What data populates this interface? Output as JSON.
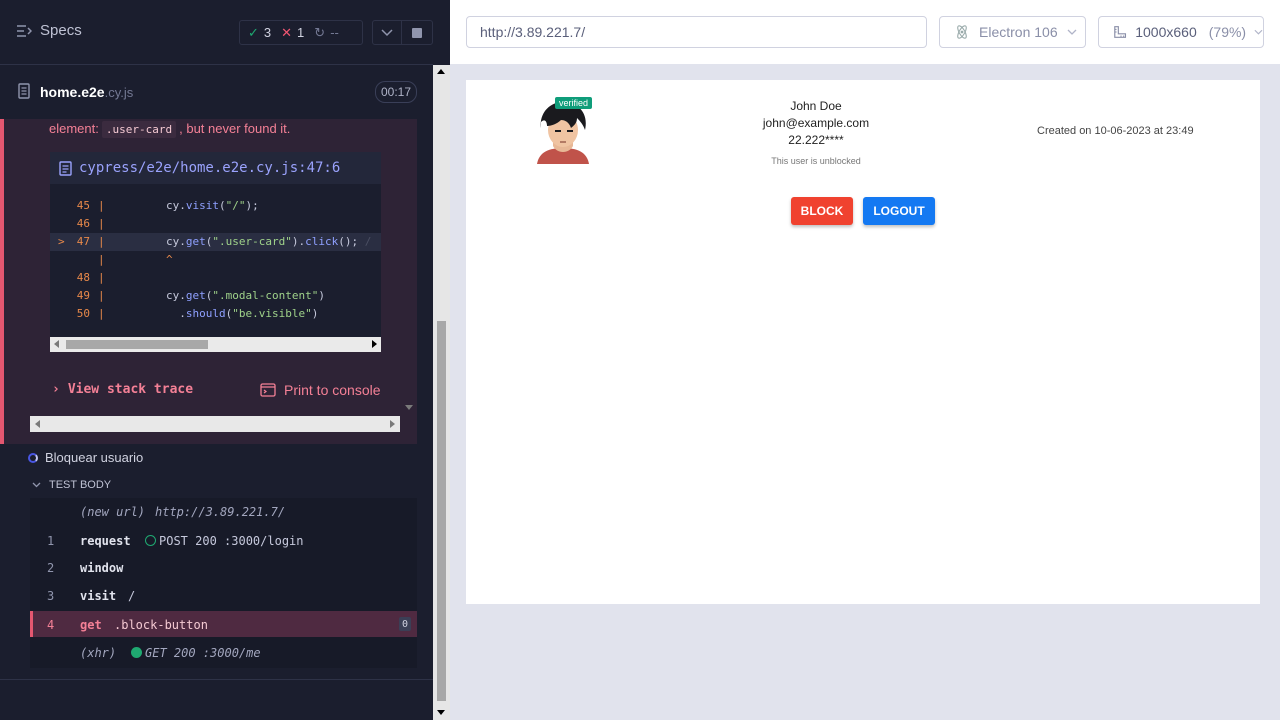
{
  "reporter": {
    "specs_label": "Specs",
    "stats": {
      "passed": "3",
      "failed": "1",
      "pending": "--"
    },
    "spec": {
      "name": "home.e2e",
      "ext": ".cy.js",
      "duration": "00:17"
    },
    "error": {
      "message_prefix": "element:",
      "selector": ".user-card",
      "message_suffix": ", but never found it.",
      "file_link": "cypress/e2e/home.e2e.cy.js:47:6",
      "code_lines": [
        {
          "num": "45",
          "fn": "cy.",
          "call": "visit",
          "args": "(\"/\");",
          "str": "",
          "tail": ""
        },
        {
          "num": "46",
          "fn": "",
          "call": "",
          "args": "",
          "str": "",
          "tail": ""
        },
        {
          "num": "47",
          "fn": "cy.",
          "call": "get",
          "args": "(",
          "str": "\".user-card\"",
          "tail": ").click(); ."
        },
        {
          "num": "",
          "fn": "",
          "call": "",
          "args": "   ^",
          "str": "",
          "tail": ""
        },
        {
          "num": "48",
          "fn": "",
          "call": "",
          "args": "",
          "str": "",
          "tail": ""
        },
        {
          "num": "49",
          "fn": "cy.",
          "call": "get",
          "args": "(",
          "str": "\".modal-content\"",
          "tail": ")"
        },
        {
          "num": "50",
          "fn": "  .",
          "call": "should",
          "args": "(",
          "str": "\"be.visible\"",
          "tail": ")"
        }
      ],
      "view_stack_trace": "View stack trace",
      "print_to_console": "Print to console"
    },
    "test2": {
      "title": "Bloquear usuario",
      "body_label": "TEST BODY",
      "commands": [
        {
          "num": "",
          "name": "(new url)",
          "msg": "http://3.89.221.7/",
          "italic": true
        },
        {
          "num": "1",
          "name": "request",
          "msg": "POST 200 :3000/login",
          "italic": false
        },
        {
          "num": "2",
          "name": "window",
          "msg": "",
          "italic": false
        },
        {
          "num": "3",
          "name": "visit",
          "msg": "/",
          "italic": false
        },
        {
          "num": "4",
          "name": "get",
          "msg": ".block-button",
          "badge": "0",
          "italic": false
        },
        {
          "num": "",
          "name": "(xhr)",
          "msg": "GET 200 :3000/me",
          "italic": true
        }
      ]
    }
  },
  "aut": {
    "url": "http://3.89.221.7/",
    "browser": "Electron 106",
    "viewport": "1000x660",
    "zoom": "(79%)",
    "user": {
      "verified_badge": "verified",
      "name": "John Doe",
      "email": "john@example.com",
      "phone": "22.222****",
      "status": "This user is unblocked",
      "created": "Created on 10-06-2023 at 23:49"
    },
    "buttons": {
      "block": "BLOCK",
      "logout": "LOGOUT"
    },
    "colors": {
      "block": "#f0422f",
      "logout": "#1479f2",
      "verified": "#0f9d7a"
    }
  }
}
